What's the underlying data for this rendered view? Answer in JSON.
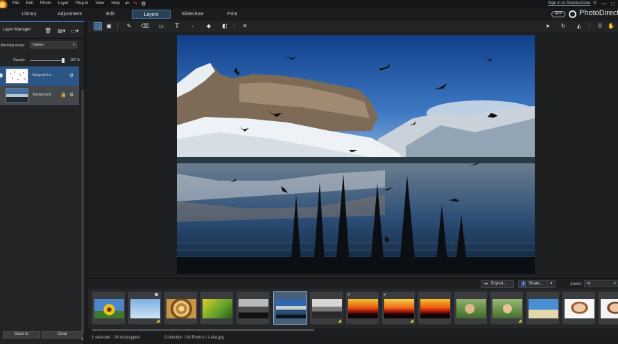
{
  "menu": [
    "File",
    "Edit",
    "Photo",
    "Layer",
    "Plug-in",
    "View",
    "Help"
  ],
  "quick_actions": {
    "undo": "↶",
    "redo": "↷",
    "settings": "⚙"
  },
  "signin": "Sign in to DirectorZone",
  "window_controls": [
    "?",
    "—",
    "□"
  ],
  "tabs": [
    "Library",
    "Adjustment",
    "Edit",
    "Layers",
    "Slideshow",
    "Print"
  ],
  "active_tab": "Layers",
  "brand": {
    "app_badge": "APP",
    "name": "PhotoDirector"
  },
  "layer_manager": {
    "title": "Layer Manager",
    "blending_label": "Blending mode:",
    "blending_value": "Darken",
    "opacity_label": "Opacity",
    "opacity_value": "100 %",
    "opacity_fraction": 1.0,
    "layers": [
      {
        "name": "flying-bird-a...",
        "selected": true
      },
      {
        "name": "Background",
        "selected": false,
        "locked": true
      }
    ],
    "save_label": "Save to",
    "clear_label": "Clear"
  },
  "toolbar": {
    "tools": [
      "select-icon",
      "image-icon",
      "brush-icon",
      "eraser-icon",
      "rectangle-icon",
      "text-icon",
      "dropper-icon",
      "fill-icon",
      "gradient-icon",
      "close-icon",
      "pointer-icon",
      "rotate-icon",
      "flip-icon",
      "zoom-icon",
      "hand-icon"
    ],
    "text_tool": "T"
  },
  "filmstrip": {
    "export_label": "Export...",
    "share_label": "Share...",
    "zoom_label": "Zoom:",
    "zoom_value": "Fit",
    "thumbnails": [
      {
        "subject": "sunflower",
        "selected": false
      },
      {
        "subject": "birds-sky",
        "selected": false
      },
      {
        "subject": "spiral-shell",
        "selected": false
      },
      {
        "subject": "green-field",
        "selected": false
      },
      {
        "subject": "bw-landscape",
        "selected": false
      },
      {
        "subject": "lake",
        "selected": true
      },
      {
        "subject": "bw-mountain",
        "selected": false
      },
      {
        "subject": "sunset-1",
        "selected": false
      },
      {
        "subject": "sunset-2",
        "selected": false
      },
      {
        "subject": "sunset-3",
        "selected": false
      },
      {
        "subject": "tiger-cub-1",
        "selected": false
      },
      {
        "subject": "tiger-cub-2",
        "selected": false
      },
      {
        "subject": "beach",
        "selected": false
      },
      {
        "subject": "portrait",
        "selected": false
      },
      {
        "subject": "portrait-2",
        "selected": false
      }
    ]
  },
  "status": {
    "selection": "1 selected · 34 displayped",
    "path": "Collection / All Photos / Lake.jpg"
  },
  "colors": {
    "accent": "#3b6ea0",
    "tab_active": "#2a4057",
    "layer_selected": "#2a5585"
  }
}
